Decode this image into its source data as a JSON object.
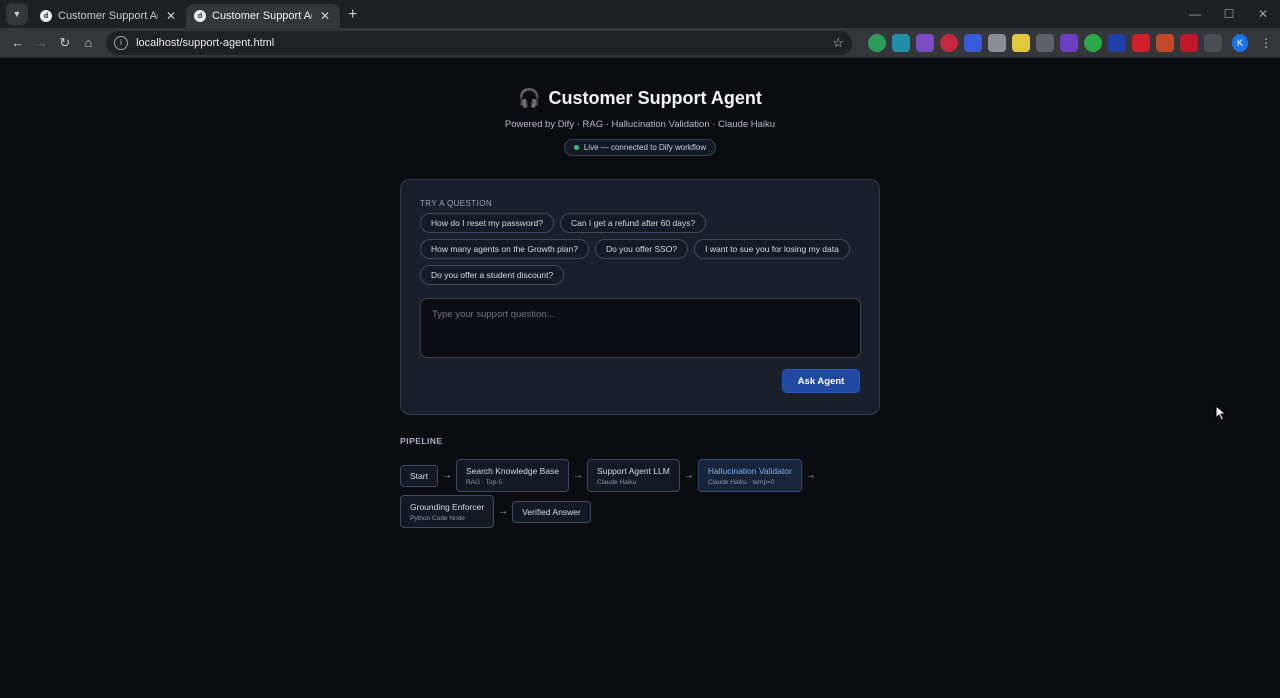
{
  "browser": {
    "tabs": [
      {
        "title": "Customer Support Agent - Dify",
        "active": false
      },
      {
        "title": "Customer Support Agent — Su",
        "active": true
      }
    ],
    "new_tab_label": "+",
    "url": "localhost/support-agent.html",
    "profile_initial": "K"
  },
  "header": {
    "title": "Customer Support Agent",
    "icon": "headphones-icon",
    "subtitle": "Powered by Dify · RAG · Hallucination Validation · Claude Haiku",
    "status": "Live — connected to Dify workflow",
    "status_color": "#3ec46d"
  },
  "card": {
    "try_label": "TRY A QUESTION",
    "chips": [
      "How do I reset my password?",
      "Can I get a refund after 60 days?",
      "How many agents on the Growth plan?",
      "Do you offer SSO?",
      "I want to sue you for losing my data",
      "Do you offer a student discount?"
    ],
    "input_placeholder": "Type your support question...",
    "input_value": "",
    "ask_button": "Ask Agent",
    "accent": "#1f4aa0"
  },
  "pipeline": {
    "title": "PIPELINE",
    "arrow": "→",
    "nodes": [
      {
        "name": "Start",
        "sub": ""
      },
      {
        "name": "Search Knowledge Base",
        "sub": "RAG · Top-5"
      },
      {
        "name": "Support Agent LLM",
        "sub": "Claude Haiku"
      },
      {
        "name": "Hallucination Validator",
        "sub": "Claude Haiku · temp=0"
      },
      {
        "name": "Grounding Enforcer",
        "sub": "Python Code Node"
      },
      {
        "name": "Verified Answer",
        "sub": ""
      }
    ]
  }
}
